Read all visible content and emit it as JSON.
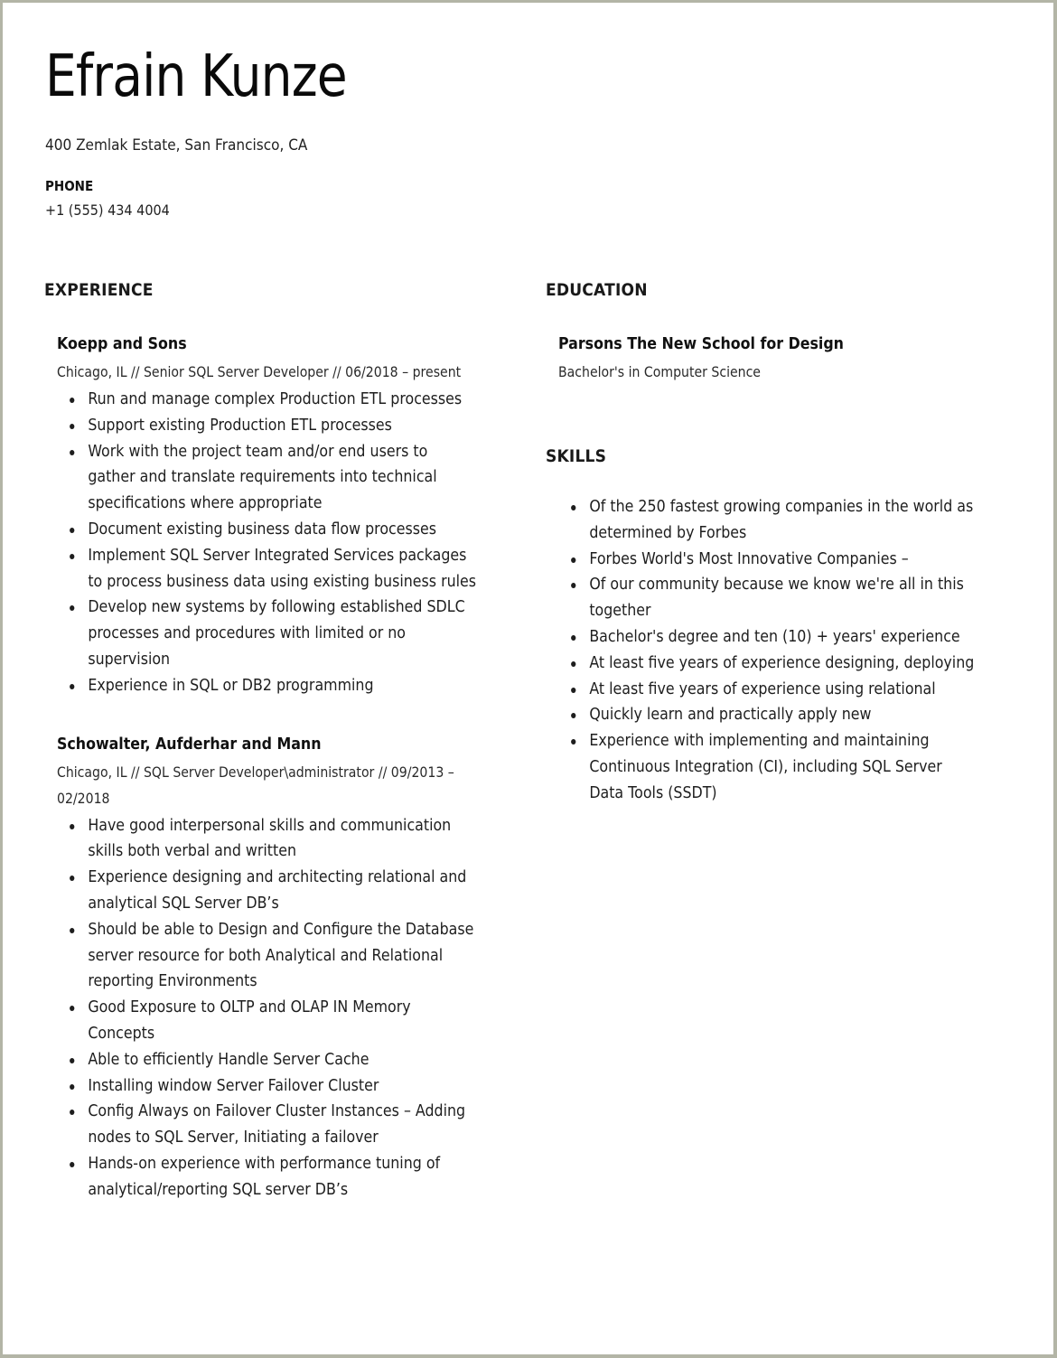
{
  "header": {
    "name": "Efrain Kunze",
    "address": "400 Zemlak Estate, San Francisco, CA",
    "phone_label": "PHONE",
    "phone_value": "+1 (555) 434 4004"
  },
  "experience": {
    "title": "EXPERIENCE",
    "jobs": [
      {
        "company": "Koepp and Sons",
        "details": "Chicago, IL // Senior SQL Server Developer // 06/2018 – present",
        "bullets": [
          "Run and manage complex Production ETL processes",
          "Support existing Production ETL processes",
          "Work with the project team and/or end users to gather and translate requirements into technical specifications where appropriate",
          "Document existing business data flow processes",
          "Implement SQL Server Integrated Services packages to process business data using existing business rules",
          "Develop new systems by following established SDLC processes and procedures with limited or no supervision",
          "Experience in SQL or DB2 programming"
        ]
      },
      {
        "company": "Schowalter, Aufderhar and Mann",
        "details": "Chicago, IL // SQL Server Developer\\administrator // 09/2013 – 02/2018",
        "bullets": [
          "Have good interpersonal skills and communication skills both verbal and written",
          "Experience designing and architecting relational and analytical SQL Server DB’s",
          "Should be able to Design and Configure the Database server resource for both Analytical and Relational reporting Environments",
          "Good Exposure to OLTP and OLAP IN Memory Concepts",
          "Able to efficiently Handle Server Cache",
          "Installing window Server Failover Cluster",
          "Config Always on Failover Cluster Instances – Adding nodes to SQL Server, Initiating a failover",
          "Hands-on experience with performance tuning of analytical/reporting SQL server DB’s"
        ]
      }
    ]
  },
  "education": {
    "title": "EDUCATION",
    "school": "Parsons The New School for Design",
    "degree": "Bachelor's in Computer Science"
  },
  "skills": {
    "title": "SKILLS",
    "items": [
      "Of the 250 fastest growing companies in the world as determined by Forbes",
      "Forbes World's Most Innovative Companies –",
      "Of our community because we know we're all in this together",
      "Bachelor's degree and ten (10) + years' experience",
      "At least five years of experience designing, deploying",
      "At least five years of experience using relational",
      "Quickly learn and practically apply new",
      "Experience with implementing and maintaining Continuous Integration (CI), including SQL Server Data Tools (SSDT)"
    ]
  }
}
